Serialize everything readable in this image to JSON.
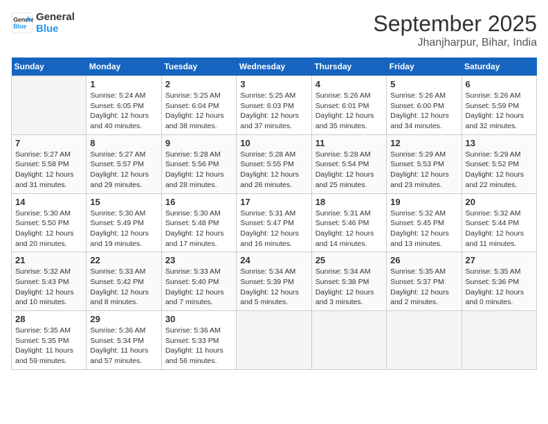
{
  "header": {
    "logo_line1": "General",
    "logo_line2": "Blue",
    "month": "September 2025",
    "location": "Jhanjharpur, Bihar, India"
  },
  "days_of_week": [
    "Sunday",
    "Monday",
    "Tuesday",
    "Wednesday",
    "Thursday",
    "Friday",
    "Saturday"
  ],
  "weeks": [
    [
      {
        "num": "",
        "info": ""
      },
      {
        "num": "1",
        "info": "Sunrise: 5:24 AM\nSunset: 6:05 PM\nDaylight: 12 hours\nand 40 minutes."
      },
      {
        "num": "2",
        "info": "Sunrise: 5:25 AM\nSunset: 6:04 PM\nDaylight: 12 hours\nand 38 minutes."
      },
      {
        "num": "3",
        "info": "Sunrise: 5:25 AM\nSunset: 6:03 PM\nDaylight: 12 hours\nand 37 minutes."
      },
      {
        "num": "4",
        "info": "Sunrise: 5:26 AM\nSunset: 6:01 PM\nDaylight: 12 hours\nand 35 minutes."
      },
      {
        "num": "5",
        "info": "Sunrise: 5:26 AM\nSunset: 6:00 PM\nDaylight: 12 hours\nand 34 minutes."
      },
      {
        "num": "6",
        "info": "Sunrise: 5:26 AM\nSunset: 5:59 PM\nDaylight: 12 hours\nand 32 minutes."
      }
    ],
    [
      {
        "num": "7",
        "info": "Sunrise: 5:27 AM\nSunset: 5:58 PM\nDaylight: 12 hours\nand 31 minutes."
      },
      {
        "num": "8",
        "info": "Sunrise: 5:27 AM\nSunset: 5:57 PM\nDaylight: 12 hours\nand 29 minutes."
      },
      {
        "num": "9",
        "info": "Sunrise: 5:28 AM\nSunset: 5:56 PM\nDaylight: 12 hours\nand 28 minutes."
      },
      {
        "num": "10",
        "info": "Sunrise: 5:28 AM\nSunset: 5:55 PM\nDaylight: 12 hours\nand 26 minutes."
      },
      {
        "num": "11",
        "info": "Sunrise: 5:28 AM\nSunset: 5:54 PM\nDaylight: 12 hours\nand 25 minutes."
      },
      {
        "num": "12",
        "info": "Sunrise: 5:29 AM\nSunset: 5:53 PM\nDaylight: 12 hours\nand 23 minutes."
      },
      {
        "num": "13",
        "info": "Sunrise: 5:29 AM\nSunset: 5:52 PM\nDaylight: 12 hours\nand 22 minutes."
      }
    ],
    [
      {
        "num": "14",
        "info": "Sunrise: 5:30 AM\nSunset: 5:50 PM\nDaylight: 12 hours\nand 20 minutes."
      },
      {
        "num": "15",
        "info": "Sunrise: 5:30 AM\nSunset: 5:49 PM\nDaylight: 12 hours\nand 19 minutes."
      },
      {
        "num": "16",
        "info": "Sunrise: 5:30 AM\nSunset: 5:48 PM\nDaylight: 12 hours\nand 17 minutes."
      },
      {
        "num": "17",
        "info": "Sunrise: 5:31 AM\nSunset: 5:47 PM\nDaylight: 12 hours\nand 16 minutes."
      },
      {
        "num": "18",
        "info": "Sunrise: 5:31 AM\nSunset: 5:46 PM\nDaylight: 12 hours\nand 14 minutes."
      },
      {
        "num": "19",
        "info": "Sunrise: 5:32 AM\nSunset: 5:45 PM\nDaylight: 12 hours\nand 13 minutes."
      },
      {
        "num": "20",
        "info": "Sunrise: 5:32 AM\nSunset: 5:44 PM\nDaylight: 12 hours\nand 11 minutes."
      }
    ],
    [
      {
        "num": "21",
        "info": "Sunrise: 5:32 AM\nSunset: 5:43 PM\nDaylight: 12 hours\nand 10 minutes."
      },
      {
        "num": "22",
        "info": "Sunrise: 5:33 AM\nSunset: 5:42 PM\nDaylight: 12 hours\nand 8 minutes."
      },
      {
        "num": "23",
        "info": "Sunrise: 5:33 AM\nSunset: 5:40 PM\nDaylight: 12 hours\nand 7 minutes."
      },
      {
        "num": "24",
        "info": "Sunrise: 5:34 AM\nSunset: 5:39 PM\nDaylight: 12 hours\nand 5 minutes."
      },
      {
        "num": "25",
        "info": "Sunrise: 5:34 AM\nSunset: 5:38 PM\nDaylight: 12 hours\nand 3 minutes."
      },
      {
        "num": "26",
        "info": "Sunrise: 5:35 AM\nSunset: 5:37 PM\nDaylight: 12 hours\nand 2 minutes."
      },
      {
        "num": "27",
        "info": "Sunrise: 5:35 AM\nSunset: 5:36 PM\nDaylight: 12 hours\nand 0 minutes."
      }
    ],
    [
      {
        "num": "28",
        "info": "Sunrise: 5:35 AM\nSunset: 5:35 PM\nDaylight: 11 hours\nand 59 minutes."
      },
      {
        "num": "29",
        "info": "Sunrise: 5:36 AM\nSunset: 5:34 PM\nDaylight: 11 hours\nand 57 minutes."
      },
      {
        "num": "30",
        "info": "Sunrise: 5:36 AM\nSunset: 5:33 PM\nDaylight: 11 hours\nand 56 minutes."
      },
      {
        "num": "",
        "info": ""
      },
      {
        "num": "",
        "info": ""
      },
      {
        "num": "",
        "info": ""
      },
      {
        "num": "",
        "info": ""
      }
    ]
  ]
}
